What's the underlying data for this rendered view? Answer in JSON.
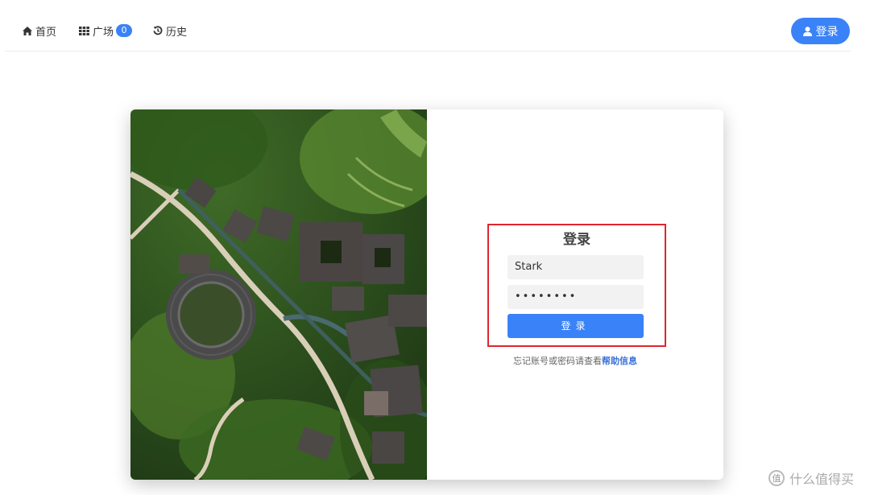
{
  "nav": {
    "home_label": "首页",
    "square_label": "广场",
    "square_count": "0",
    "history_label": "历史",
    "login_label": "登录"
  },
  "login_form": {
    "title": "登录",
    "username_value": "Stark",
    "password_value": "••••••••",
    "submit_label": "登录"
  },
  "help": {
    "text": "忘记账号或密码请查看",
    "link_label": "帮助信息"
  },
  "watermark": {
    "icon_glyph": "值",
    "text": "什么值得买"
  },
  "colors": {
    "accent": "#3a82f7",
    "highlight_border": "#e0252e"
  }
}
